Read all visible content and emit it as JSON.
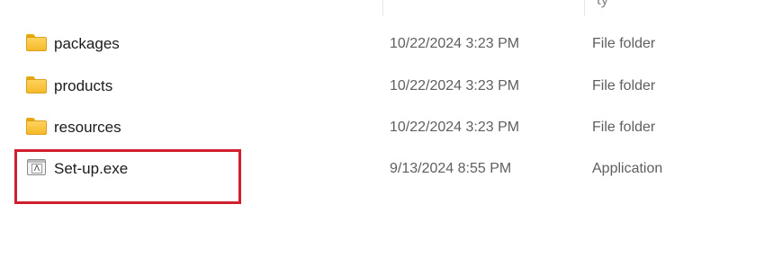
{
  "file_list": {
    "header_fragment": "ty",
    "rows": [
      {
        "icon": "folder-icon",
        "name": "packages",
        "date_modified": "10/22/2024 3:23 PM",
        "type": "File folder"
      },
      {
        "icon": "folder-icon",
        "name": "products",
        "date_modified": "10/22/2024 3:23 PM",
        "type": "File folder"
      },
      {
        "icon": "folder-icon",
        "name": "resources",
        "date_modified": "10/22/2024 3:23 PM",
        "type": "File folder"
      },
      {
        "icon": "application-icon",
        "name": "Set-up.exe",
        "date_modified": "9/13/2024 8:55 PM",
        "type": "Application"
      }
    ]
  },
  "highlight": {
    "target": "Set-up.exe",
    "color": "#d0202e"
  },
  "colors": {
    "folder": "#f5b92a",
    "secondary_text": "#5f5f5f",
    "primary_text": "#1b1b1b"
  }
}
